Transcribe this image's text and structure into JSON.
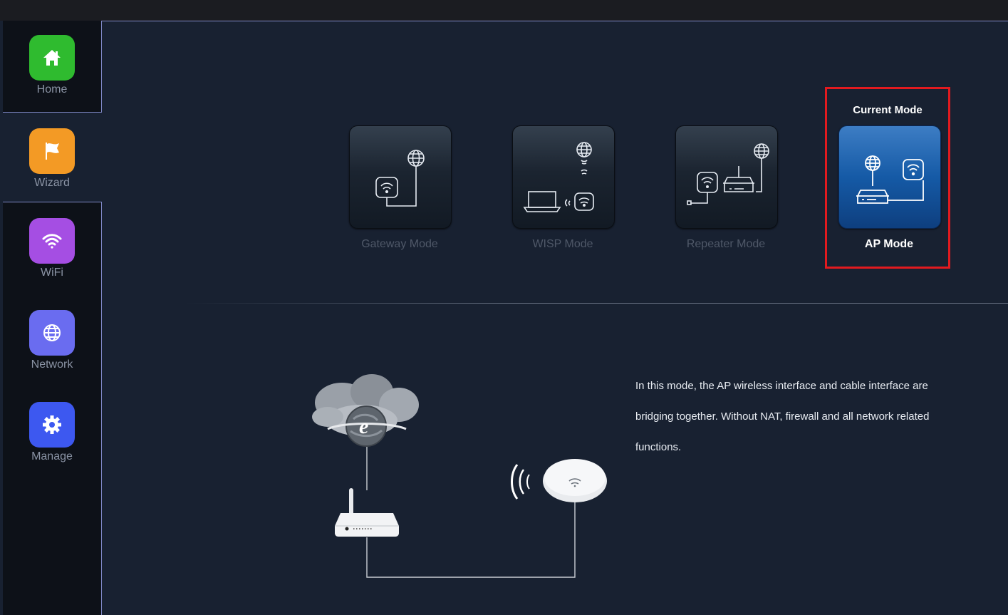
{
  "sidebar": {
    "items": [
      {
        "label": "Home",
        "icon": "home-icon",
        "color": "#2fbb2f"
      },
      {
        "label": "Wizard",
        "icon": "flag-icon",
        "color": "#f39a25"
      },
      {
        "label": "WiFi",
        "icon": "wifi-icon",
        "color": "#a54ee3"
      },
      {
        "label": "Network",
        "icon": "globe-icon",
        "color": "#6a6cf0"
      },
      {
        "label": "Manage",
        "icon": "gear-icon",
        "color": "#3d58f0"
      }
    ],
    "active": "Wizard"
  },
  "modes": {
    "current_title": "Current Mode",
    "items": [
      {
        "label": "Gateway Mode"
      },
      {
        "label": "WISP Mode"
      },
      {
        "label": "Repeater Mode"
      },
      {
        "label": "AP Mode",
        "current": true
      }
    ]
  },
  "description": "In this mode, the AP wireless interface and cable interface are bridging together. Without NAT, firewall and all network related functions.",
  "colors": {
    "background": "#182131",
    "highlight_border": "#e21a1f",
    "current_card": "#155aa6"
  }
}
